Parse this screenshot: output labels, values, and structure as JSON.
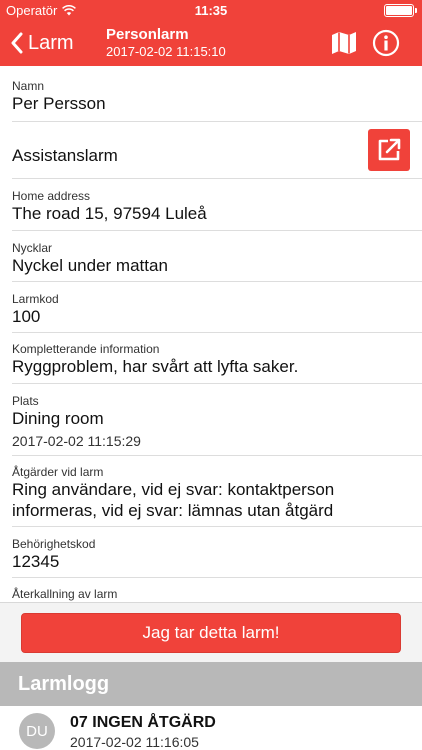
{
  "status_bar": {
    "carrier": "Operatör",
    "time": "11:35"
  },
  "nav": {
    "back_label": "Larm",
    "title": "Personlarm",
    "subtitle": "2017-02-02 11:15:10",
    "icons": {
      "back": "chevron-left-icon",
      "map": "map-icon",
      "info": "info-icon"
    }
  },
  "fields": {
    "name": {
      "label": "Namn",
      "value": "Per Persson"
    },
    "alarm_type": {
      "value": "Assistanslarm",
      "action_icon": "open-external-icon"
    },
    "home_address": {
      "label": "Home address",
      "value": "The road 15, 97594 Luleå"
    },
    "keys": {
      "label": "Nycklar",
      "value": "Nyckel under mattan"
    },
    "alarm_code": {
      "label": "Larmkod",
      "value": "100"
    },
    "additional_info": {
      "label": "Kompletterande information",
      "value": "Ryggproblem, har svårt att lyfta saker."
    },
    "location": {
      "label": "Plats",
      "value": "Dining room",
      "time": "2017-02-02 11:15:29"
    },
    "actions": {
      "label": "Åtgärder vid larm",
      "value": "Ring användare, vid ej svar: kontaktperson informeras, vid ej svar: lämnas utan åtgärd"
    },
    "auth_code": {
      "label": "Behörighetskod",
      "value": "12345"
    },
    "recall": {
      "label": "Återkallning av larm"
    }
  },
  "action_button": {
    "label": "Jag tar detta larm!"
  },
  "log": {
    "header": "Larmlogg",
    "items": [
      {
        "avatar": "DU",
        "title": "07 INGEN ÅTGÄRD",
        "time": "2017-02-02 11:16:05"
      }
    ]
  },
  "colors": {
    "accent": "#f0423a",
    "log_header_bg": "#b8b8b8",
    "divider": "#dddddd"
  }
}
